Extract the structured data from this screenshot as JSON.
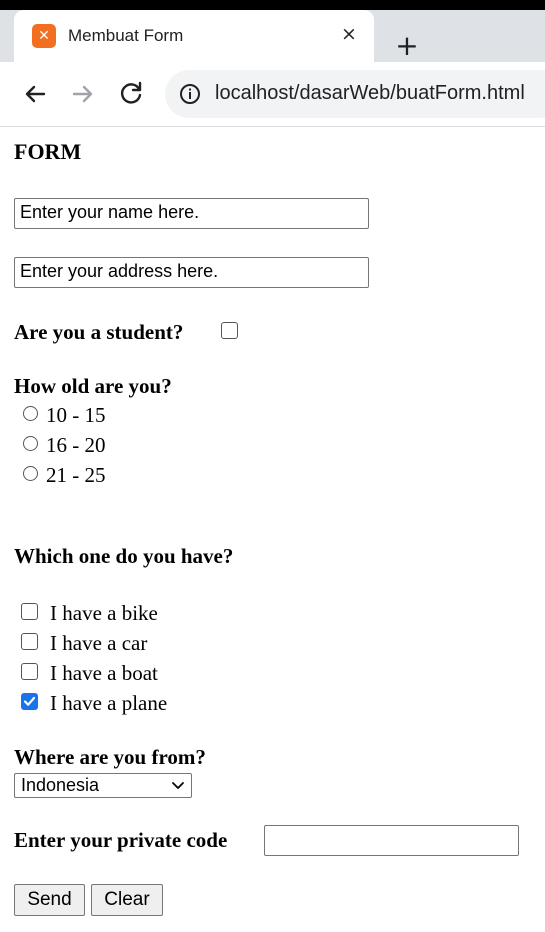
{
  "browser": {
    "tab_title": "Membuat Form",
    "favicon_label": "✕",
    "close_glyph": "×",
    "newtab_glyph": "+",
    "url": "localhost/dasarWeb/buatForm.html"
  },
  "page": {
    "heading": "FORM",
    "name_input": {
      "value": "Enter your name here."
    },
    "address_input": {
      "value": "Enter your address here."
    },
    "student_question": "Are you a student?",
    "student_checked": false,
    "age_question": "How old are you?",
    "age_options": [
      "10 - 15",
      "16 - 20",
      "21 - 25"
    ],
    "have_question": "Which one do you have?",
    "have_options": [
      {
        "label": "I have a bike",
        "checked": false
      },
      {
        "label": "I have a car",
        "checked": false
      },
      {
        "label": "I have a boat",
        "checked": false
      },
      {
        "label": "I have a plane",
        "checked": true
      }
    ],
    "from_question": "Where are you from?",
    "country_selected": "Indonesia",
    "code_label": "Enter your private code",
    "send_label": "Send",
    "clear_label": "Clear"
  },
  "colors": {
    "checkbox_checked": "#1a73e8",
    "favicon": "#f26f21",
    "tabstrip": "#dee1e6",
    "omnibox": "#f1f3f4"
  }
}
